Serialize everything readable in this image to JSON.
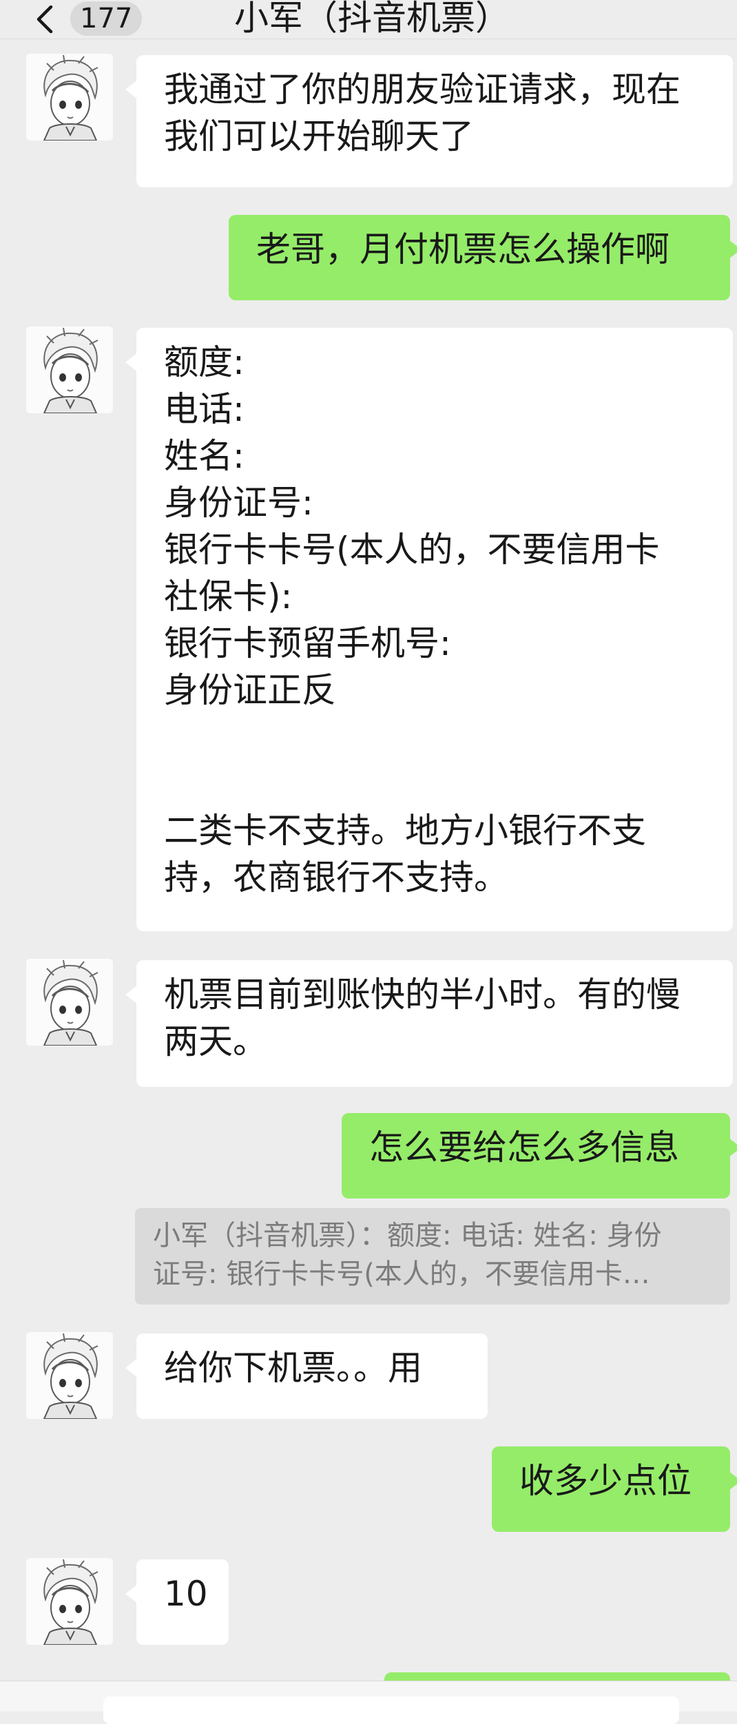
{
  "header": {
    "unread_count": "177",
    "title": "小军（抖音机票）"
  },
  "messages": [
    {
      "side": "left",
      "text": "我通过了你的朋友验证请求，现在\n我们可以开始聊天了"
    },
    {
      "side": "right",
      "text": "老哥，月付机票怎么操作啊"
    },
    {
      "side": "left",
      "text": "额度:\n电话:\n姓名:\n身份证号:\n银行卡卡号(本人的，不要信用卡\n社保卡):\n银行卡预留手机号:\n身份证正反\n\n\n二类卡不支持。地方小银行不支\n持，农商银行不支持。"
    },
    {
      "side": "left",
      "text": "机票目前到账快的半小时。有的慢\n两天。"
    },
    {
      "side": "right",
      "text": "怎么要给怎么多信息"
    },
    {
      "side": "left",
      "text": "给你下机票。。用"
    },
    {
      "side": "right",
      "text": "收多少点位"
    },
    {
      "side": "left",
      "text": "10"
    }
  ],
  "quote": {
    "line1": "小军（抖音机票）：额度: 电话: 姓名: 身份",
    "line2": "证号: 银行卡卡号(本人的，不要信用卡…"
  },
  "icons": {
    "back": "chevron-left-icon",
    "avatar": "anime-boy-avatar-icon"
  },
  "colors": {
    "background": "#ededed",
    "incoming_bubble": "#ffffff",
    "outgoing_bubble": "#95ec69",
    "quote_bg": "#dadada"
  }
}
